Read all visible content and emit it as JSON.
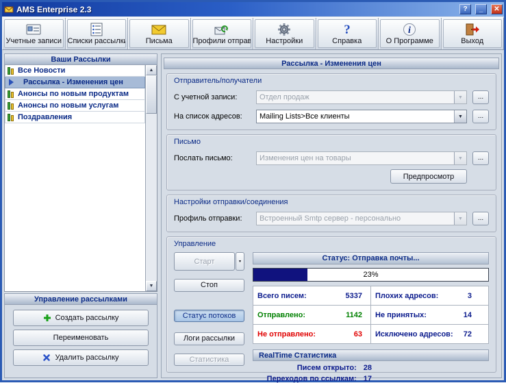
{
  "window": {
    "title": "AMS Enterprise 2.3",
    "controls": {
      "help": "?",
      "minimize": "_",
      "close": "✕"
    }
  },
  "toolbar": {
    "items": [
      {
        "label": "Учетные записи"
      },
      {
        "label": "Списки рассылки"
      },
      {
        "label": "Письма"
      },
      {
        "label": "Профили отправки"
      },
      {
        "label": "Настройки"
      },
      {
        "label": "Справка"
      },
      {
        "label": "О Программе"
      },
      {
        "label": "Выход"
      }
    ]
  },
  "sidebar": {
    "header": "Ваши Рассылки",
    "items": [
      {
        "label": "Все Новости",
        "selected": false
      },
      {
        "label": "Рассылка - Изменения цен",
        "selected": true
      },
      {
        "label": "Анонсы по новым продуктам",
        "selected": false
      },
      {
        "label": "Анонсы по новым услугам",
        "selected": false
      },
      {
        "label": "Поздравления",
        "selected": false
      }
    ],
    "management": {
      "header": "Управление рассылками",
      "create_label": "Создать рассылку",
      "rename_label": "Переименовать",
      "delete_label": "Удалить рассылку"
    }
  },
  "main": {
    "title": "Рассылка - Изменения цен",
    "browse_label": "...",
    "sender_group": {
      "title": "Отправитель/получатели",
      "account_label": "С учетной записи:",
      "account_value": "Отдел продаж",
      "list_label": "На список адресов:",
      "list_value": "Mailing Lists>Все клиенты"
    },
    "letter_group": {
      "title": "Письмо",
      "letter_label": "Послать письмо:",
      "letter_value": "Изменения цен на товары",
      "preview_label": "Предпросмотр"
    },
    "profile_group": {
      "title": "Настройки отправки/соединения",
      "profile_label": "Профиль отправки:",
      "profile_value": "Встроенный Smtp сервер - персонально"
    },
    "control_group": {
      "title": "Управление",
      "start_label": "Старт",
      "stop_label": "Стоп",
      "thread_status_label": "Статус потоков",
      "logs_label": "Логи рассылки",
      "statistics_label": "Статистика",
      "status_text": "Статус: Отправка почты...",
      "progress_percent": 23,
      "progress_label": "23%",
      "stats_rows": [
        {
          "c1_label": "Всего писем:",
          "c1_value": "5337",
          "c2_label": "Плохих адресов:",
          "c2_value": "3"
        },
        {
          "c1_label": "Отправлено:",
          "c1_value": "1142",
          "c2_label": "Не принятых:",
          "c2_value": "14"
        },
        {
          "c1_label": "Не отправлено:",
          "c1_value": "63",
          "c2_label": "Исключено адресов:",
          "c2_value": "72"
        }
      ],
      "realtime": {
        "header": "RealTime Статистика",
        "rows": [
          {
            "label": "Писем открыто:",
            "value": "28"
          },
          {
            "label": "Переходов по ссылкам:",
            "value": "17"
          }
        ]
      }
    }
  },
  "colors": {
    "navy": "#0a1a8c",
    "green": "#008000",
    "red": "#e00000",
    "progress_fill": "#10127e"
  }
}
